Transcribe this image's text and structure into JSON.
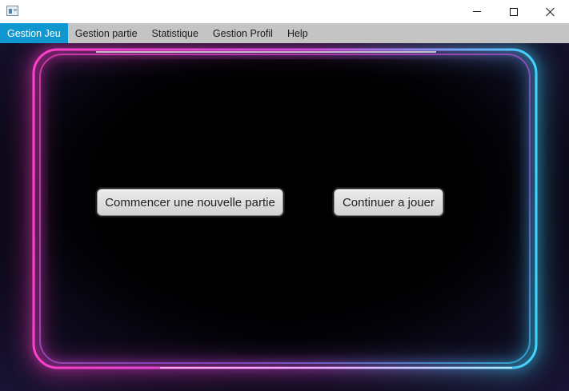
{
  "window": {
    "icon": "app-window-icon",
    "controls": [
      "minimize-icon",
      "maximize-icon",
      "close-icon"
    ]
  },
  "menu": {
    "items": [
      {
        "label": "Gestion Jeu",
        "active": true
      },
      {
        "label": "Gestion partie",
        "active": false
      },
      {
        "label": "Statistique",
        "active": false
      },
      {
        "label": "Gestion Profil",
        "active": false
      },
      {
        "label": "Help",
        "active": false
      }
    ],
    "active_color": "#0f97cf",
    "bar_color": "#c4c4c4"
  },
  "main": {
    "new_game_label": "Commencer une nouvelle partie",
    "continue_label": "Continuer a jouer"
  },
  "theme": {
    "neon_pink": "#ff3fc8",
    "neon_cyan": "#3fd8ff",
    "background": "#000000"
  }
}
